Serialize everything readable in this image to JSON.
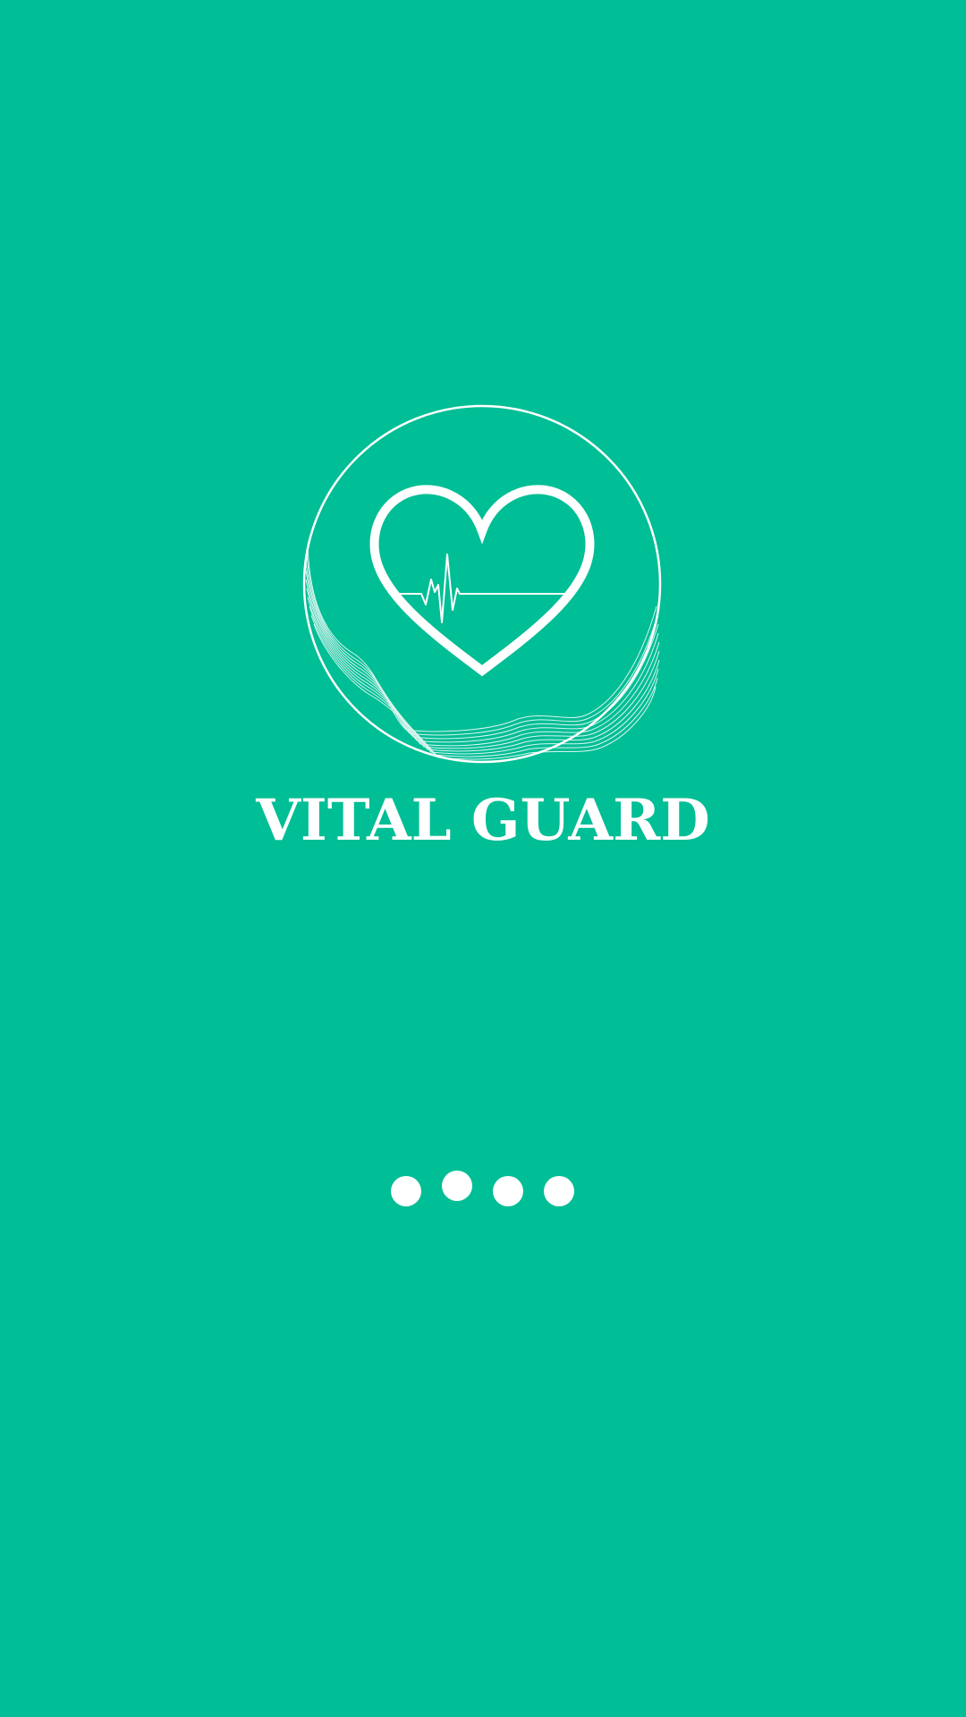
{
  "app": {
    "name": "VITAL GUARD",
    "background_color": "#00BE95",
    "foreground_color": "#FFFFFF"
  },
  "logo": {
    "icons": [
      "circle-emblem-icon",
      "heart-icon",
      "heartbeat-pulse-icon",
      "wave-lines-icon"
    ]
  },
  "loader": {
    "dot_count": 4
  }
}
